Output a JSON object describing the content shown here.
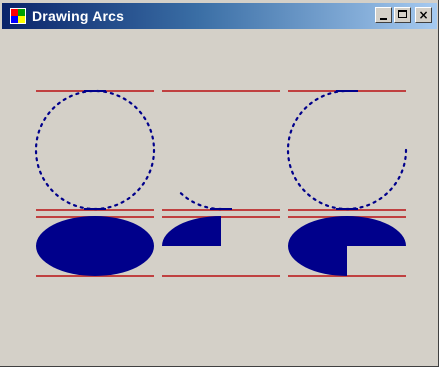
{
  "window": {
    "title": "Drawing Arcs",
    "controls": {
      "minimize_icon": "minimize-icon",
      "maximize_icon": "maximize-icon",
      "close_label": "×"
    }
  },
  "colors": {
    "title_active": "#0a246a",
    "title_fade": "#a6caf0",
    "client_background": "#d4d0c8",
    "guide_lines": "#c04040",
    "arc_shapes": "#00008b"
  },
  "drawings": {
    "top_row": [
      {
        "name": "arc-full-circle",
        "start_angle": 0,
        "sweep_angle": 360
      },
      {
        "name": "arc-small",
        "start_angle": 90,
        "sweep_angle": 45
      },
      {
        "name": "arc-three-quarter",
        "start_angle": 0,
        "sweep_angle": 270
      }
    ],
    "bottom_row": [
      {
        "name": "pie-full-ellipse",
        "start_angle": 0,
        "sweep_angle": 360
      },
      {
        "name": "pie-wedge-small",
        "start_angle": 180,
        "sweep_angle": 90
      },
      {
        "name": "pie-three-quarter",
        "start_angle": 0,
        "sweep_angle": 270
      }
    ]
  }
}
